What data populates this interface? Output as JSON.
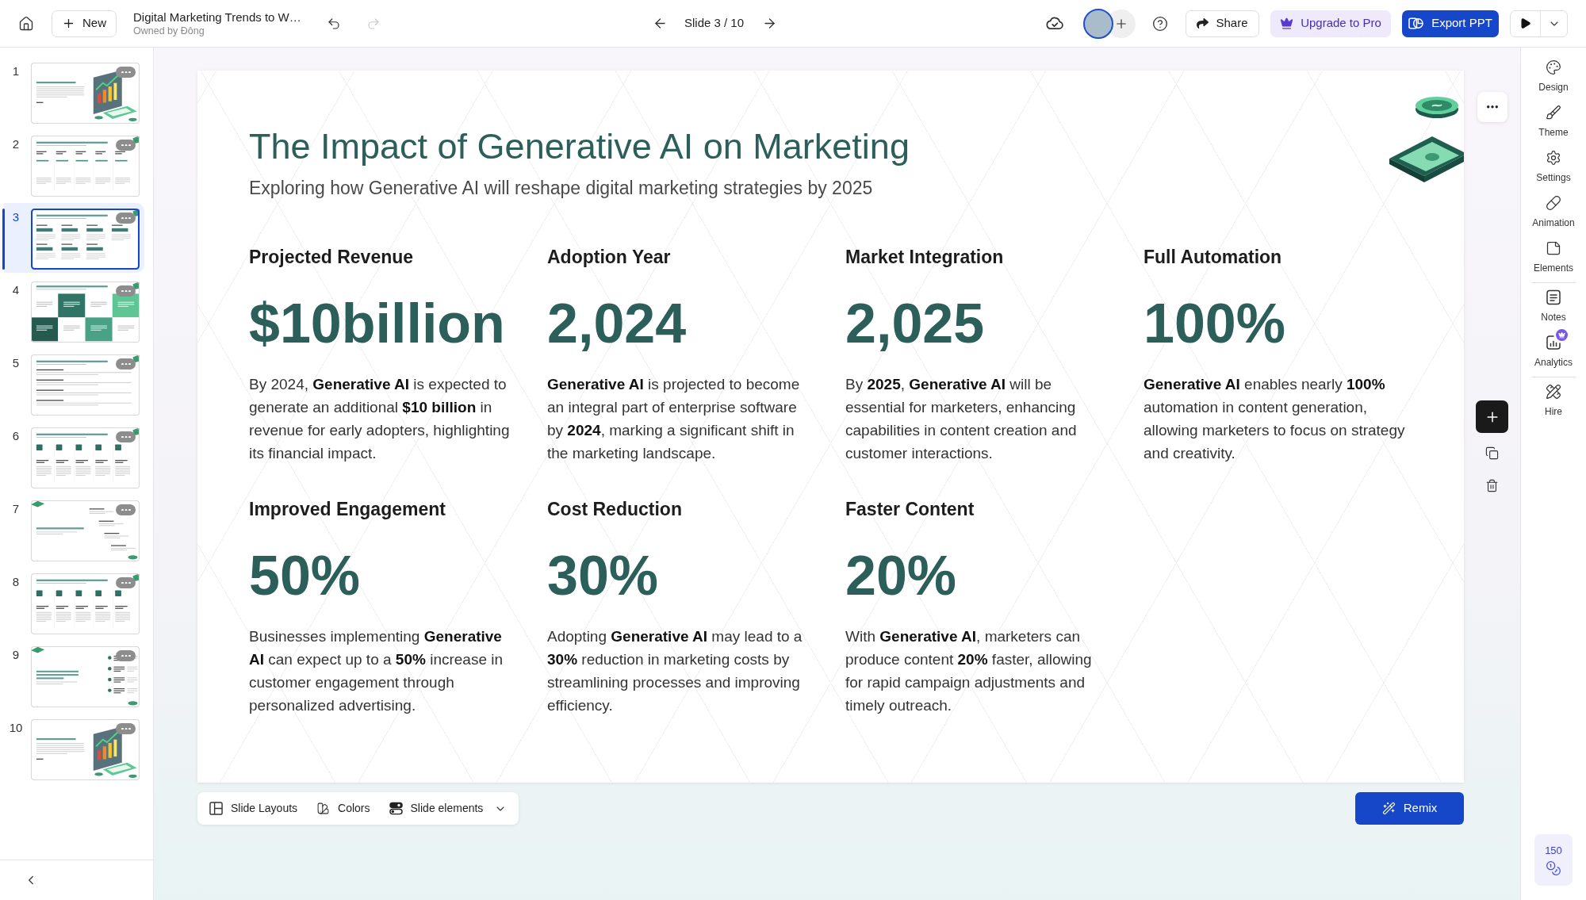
{
  "topbar": {
    "new_label": "New",
    "document": {
      "title": "Digital Marketing Trends to W…",
      "owner": "Owned by Đông"
    },
    "undo": {
      "disabled": false
    },
    "redo": {
      "disabled": true
    },
    "slide_indicator": "Slide 3 / 10",
    "share": "Share",
    "upgrade": "Upgrade to Pro",
    "export": "Export PPT"
  },
  "slides": [
    {
      "number": "1",
      "kind": "image",
      "selected": false
    },
    {
      "number": "2",
      "kind": "columns",
      "selected": false
    },
    {
      "number": "3",
      "kind": "stats",
      "selected": true
    },
    {
      "number": "4",
      "kind": "tiles",
      "selected": false
    },
    {
      "number": "5",
      "kind": "list",
      "selected": false
    },
    {
      "number": "6",
      "kind": "icon-columns",
      "selected": false
    },
    {
      "number": "7",
      "kind": "steps",
      "selected": false
    },
    {
      "number": "8",
      "kind": "icon-columns",
      "selected": false
    },
    {
      "number": "9",
      "kind": "checklist",
      "selected": false
    },
    {
      "number": "10",
      "kind": "image",
      "selected": false
    }
  ],
  "slide": {
    "title": "The Impact of Generative AI on Marketing",
    "subtitle": "Exploring how Generative AI will reshape digital marketing strategies by 2025",
    "stats": [
      {
        "heading": "Projected Revenue",
        "value": "$10billion",
        "text": "By 2024, **Generative AI** is expected to generate an additional **$10 billion** in revenue for early adopters, highlighting its financial impact."
      },
      {
        "heading": "Adoption Year",
        "value": "2,024",
        "text": "**Generative AI** is projected to become an integral part of enterprise software by **2024**, marking a significant shift in the marketing landscape."
      },
      {
        "heading": "Market Integration",
        "value": "2,025",
        "text": "By **2025**, **Generative AI** will be essential for marketers, enhancing capabilities in content creation and customer interactions."
      },
      {
        "heading": "Full Automation",
        "value": "100%",
        "text": "**Generative AI** enables nearly **100%** automation in content generation, allowing marketers to focus on strategy and creativity."
      },
      {
        "heading": "Improved Engagement",
        "value": "50%",
        "text": "Businesses implementing **Generative AI** can expect up to a **50%** increase in customer engagement through personalized advertising."
      },
      {
        "heading": "Cost Reduction",
        "value": "30%",
        "text": "Adopting **Generative AI** may lead to a **30%** reduction in marketing costs by streamlining processes and improving efficiency."
      },
      {
        "heading": "Faster Content",
        "value": "20%",
        "text": "With **Generative AI**, marketers can produce content **20%** faster, allowing for rapid campaign adjustments and timely outreach."
      }
    ]
  },
  "slide_toolbar": {
    "items": [
      {
        "kind": "layouts",
        "label": "Slide Layouts",
        "dropdown": false
      },
      {
        "kind": "colors",
        "label": "Colors",
        "dropdown": false
      },
      {
        "kind": "elements",
        "label": "Slide elements",
        "dropdown": true
      }
    ],
    "remix": "Remix"
  },
  "tools": [
    [
      {
        "kind": "design",
        "label": "Design",
        "premium": false
      },
      {
        "kind": "theme",
        "label": "Theme",
        "premium": false
      },
      {
        "kind": "settings",
        "label": "Settings",
        "premium": false
      },
      {
        "kind": "animation",
        "label": "Animation",
        "premium": false
      },
      {
        "kind": "elements",
        "label": "Elements",
        "premium": false
      }
    ],
    [
      {
        "kind": "notes",
        "label": "Notes",
        "premium": false
      },
      {
        "kind": "analytics",
        "label": "Analytics",
        "premium": true
      }
    ],
    [
      {
        "kind": "hire",
        "label": "Hire",
        "premium": false
      }
    ]
  ],
  "credits": "150"
}
